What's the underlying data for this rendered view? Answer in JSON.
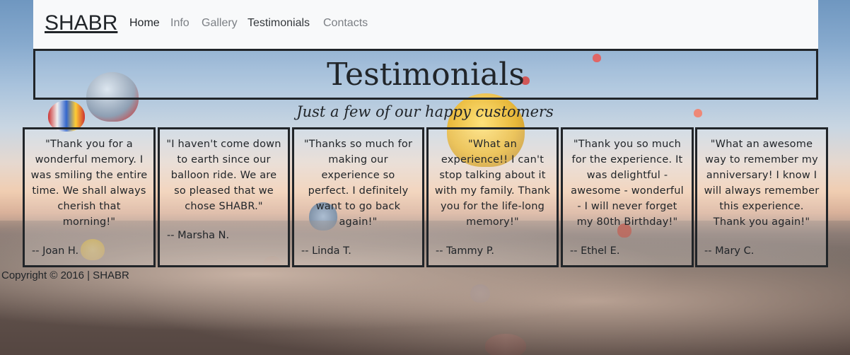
{
  "nav": {
    "brand": "SHABR",
    "items": [
      {
        "label": "Home"
      },
      {
        "label": "Info"
      },
      {
        "label": "Gallery"
      },
      {
        "label": "Testimonials"
      },
      {
        "label": "Contacts"
      }
    ]
  },
  "header": {
    "title": "Testimonials",
    "subtitle": "Just a few of our happy customers"
  },
  "testimonials": [
    {
      "quote": "\"Thank you for a wonderful memory. I was smiling the entire time. We shall always cherish that morning!\"",
      "author": "-- Joan H."
    },
    {
      "quote": "\"I haven't come down to earth since our balloon ride. We are so pleased that we chose SHABR.\"",
      "author": "-- Marsha N."
    },
    {
      "quote": "\"Thanks so much for making our experience so perfect. I definitely want to go back again!\"",
      "author": "-- Linda T."
    },
    {
      "quote": "\"What an experience!! I can't stop talking about it with my family. Thank you for the life-long memory!\"",
      "author": "-- Tammy P."
    },
    {
      "quote": "\"Thank you so much for the experience. It was delightful - awesome - wonderful - I will never forget my 80th Birthday!\"",
      "author": "-- Ethel E."
    },
    {
      "quote": "\"What an awesome way to remember my anniversary! I know I will always remember this experience. Thank you again!\"",
      "author": "-- Mary C."
    }
  ],
  "footer": {
    "copyright": "Copyright © 2016 | SHABR"
  }
}
